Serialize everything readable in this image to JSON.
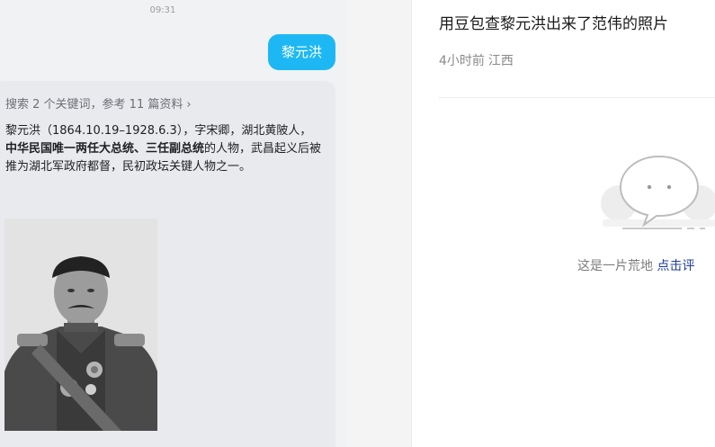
{
  "chat": {
    "time": "09:31",
    "user_message": "黎元洪",
    "search_summary": "搜索 2 个关键词，参考 11 篇资料",
    "answer": {
      "part1": "黎元洪（1864.10.19–1928.6.3），字宋卿，湖北黄陂人，",
      "bold1": "中华民国唯一两任大总统、三任副总统",
      "part2": "的人物，武昌起义后被推为湖北军政府都督，民初政坛关键人物之一。"
    },
    "image_alt": "黎元洪 portrait"
  },
  "feed": {
    "title": "用豆包查黎元洪出来了范伟的照片",
    "meta_time": "4小时前",
    "meta_location": "江西",
    "empty_text": "这是一片荒地",
    "empty_link": "点击评"
  },
  "colors": {
    "accent_blue": "#1db8f4",
    "link_blue": "#1f3f9c"
  },
  "icons": {
    "chevron": "chevron-right-icon",
    "empty": "speech-bubble-icon"
  }
}
